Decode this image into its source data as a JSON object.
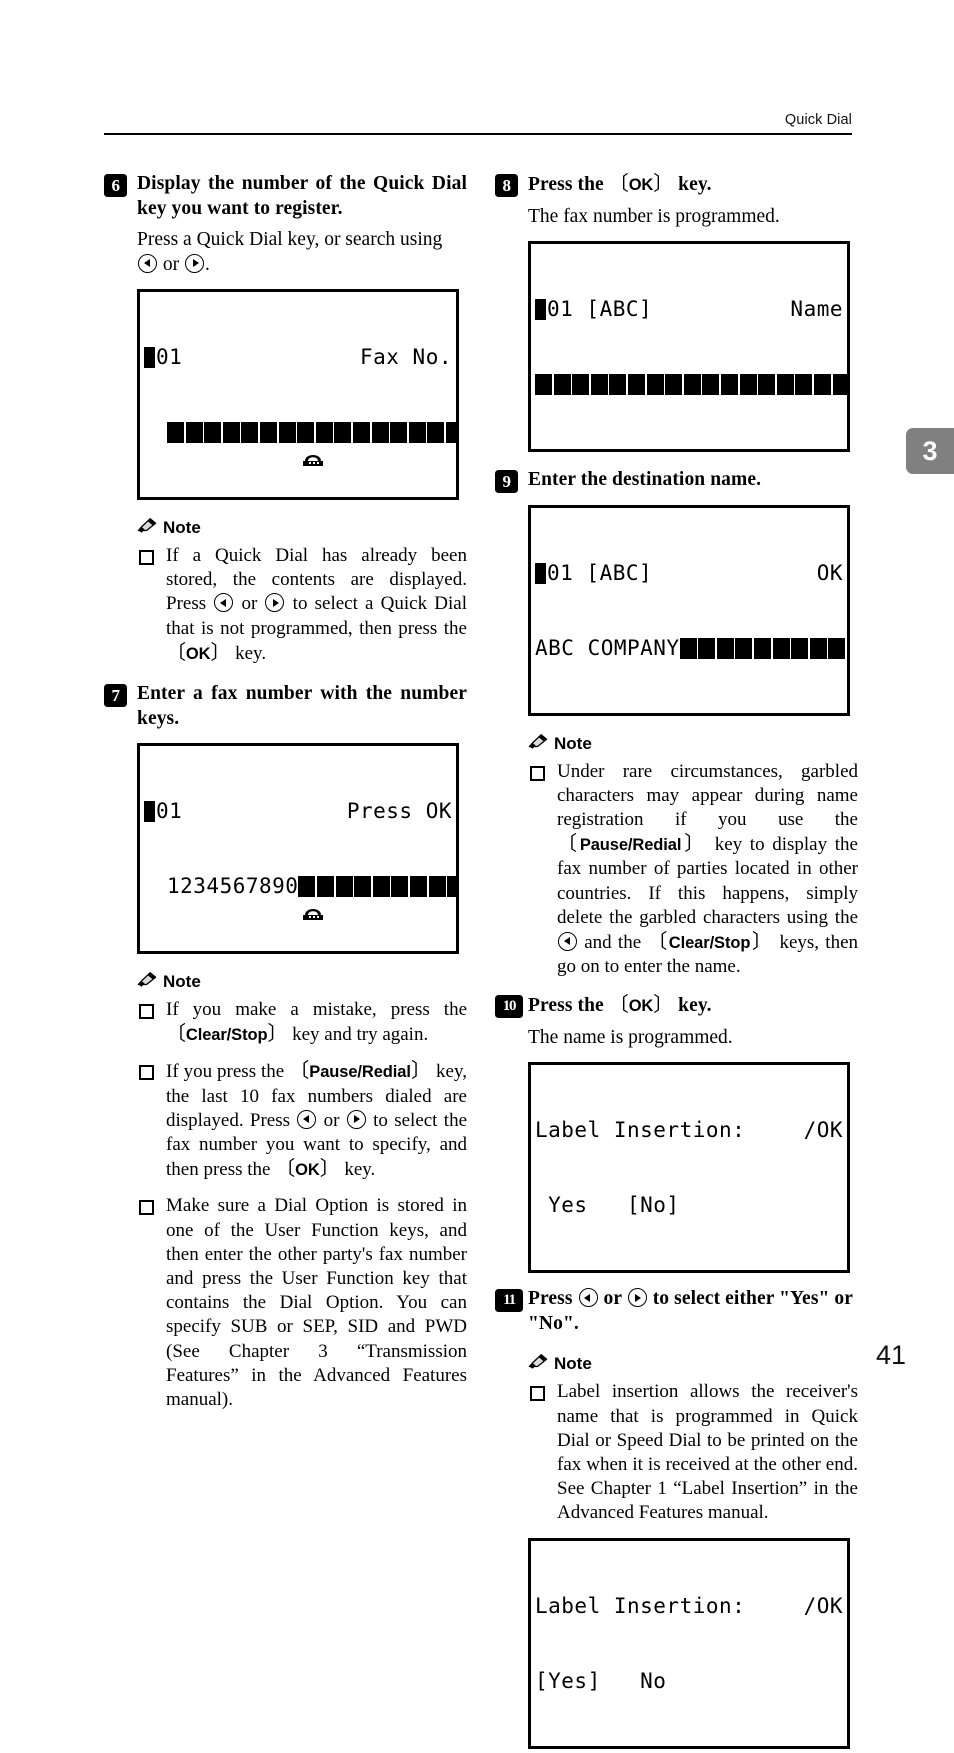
{
  "header": {
    "title": "Quick Dial"
  },
  "chapter_tab": {
    "number": "3"
  },
  "page_number": "41",
  "left_column": {
    "step6": {
      "number": "6",
      "heading": "Display the number of the Quick Dial key you want to register.",
      "body_prefix": "Press a Quick Dial key, or search using ",
      "body_mid": " or ",
      "body_suffix": ".",
      "lcd": {
        "line1_left": "01",
        "line1_right": "Fax No.",
        "line2_text": "",
        "line2_blocks": 19
      }
    },
    "note1": {
      "label": "Note",
      "items": [
        {
          "part1": "If a Quick Dial has already been stored, the contents are displayed. Press ",
          "part2": " or ",
          "part3": " to select a Quick Dial that is not programmed, then press the ",
          "key": "OK",
          "part4": " key."
        }
      ]
    },
    "step7": {
      "number": "7",
      "heading": "Enter a fax number with the number keys.",
      "lcd": {
        "line1_left": "01",
        "line1_right": "Press OK",
        "line2_text": "1234567890",
        "line2_blocks": 10
      }
    },
    "note2": {
      "label": "Note",
      "items": [
        {
          "part1": "If you make a mistake, press the ",
          "key1": "Clear/Stop",
          "part2": " key and try again."
        },
        {
          "part1": "If you press the ",
          "key1": "Pause/Redial",
          "part2": " key, the last 10 fax numbers dialed are displayed. Press ",
          "part3": " or ",
          "part4": " to select the fax number you want to specify, and then press the ",
          "key2": "OK",
          "part5": " key."
        },
        {
          "text": "Make sure a Dial Option is stored in one of the User Function keys, and then enter the other party's fax number and press the User Function key that contains the Dial Option. You can specify SUB or SEP, SID and PWD (See Chapter 3 “Transmission Features” in the Advanced Features manual)."
        }
      ]
    }
  },
  "right_column": {
    "step8": {
      "number": "8",
      "heading_prefix": "Press the ",
      "heading_key": "OK",
      "heading_suffix": " key.",
      "body": "The fax number is programmed.",
      "lcd": {
        "line1_left": "01 [ABC]",
        "line1_right": "Name",
        "line2_text": "",
        "line2_blocks": 18
      }
    },
    "step9": {
      "number": "9",
      "heading": "Enter the destination name.",
      "lcd": {
        "line1_left": "01 [ABC]",
        "line1_right": "OK",
        "line2_text": "ABC COMPANY",
        "line2_blocks": 9
      }
    },
    "note3": {
      "label": "Note",
      "items": [
        {
          "part1": "Under rare circumstances, garbled characters may appear during name registration if you use the ",
          "key1": "Pause/Redial",
          "part2": " key to display the fax number of parties located in other countries. If this happens, simply delete the garbled characters using the ",
          "part3": " and the ",
          "key2": "Clear/Stop",
          "part4": " keys, then go on to enter the name."
        }
      ]
    },
    "step10": {
      "number": "10",
      "heading_prefix": "Press the ",
      "heading_key": "OK",
      "heading_suffix": " key.",
      "body": "The name is programmed.",
      "lcd": {
        "line1_text": "Label Insertion:",
        "line1_right": "/OK",
        "line2_text": " Yes   [No]"
      }
    },
    "step11": {
      "number": "11",
      "heading_prefix": "Press ",
      "heading_mid": " or ",
      "heading_suffix": " to select either \"Yes\" or \"No\".",
      "note": {
        "label": "Note",
        "items": [
          {
            "text": "Label insertion allows the receiver's name that is programmed in Quick Dial or Speed Dial to be printed on the fax when it is received at the other end. See Chapter 1 “Label Insertion” in the Advanced Features manual."
          }
        ]
      },
      "lcd": {
        "line1_text": "Label Insertion:",
        "line1_right": "/OK",
        "line2_text": "[Yes]   No"
      }
    }
  }
}
